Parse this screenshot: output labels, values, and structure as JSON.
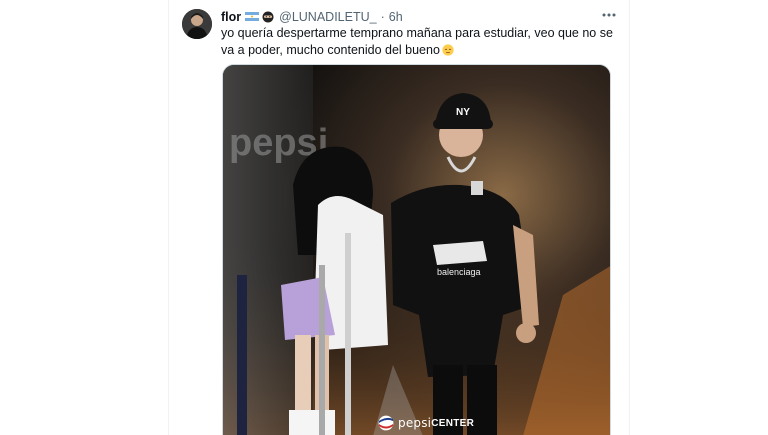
{
  "tweet": {
    "display_name": "flor",
    "handle": "@LUNADILETU_",
    "separator": "·",
    "time": "6h",
    "text": "yo quería despertarme temprano mañana para estudiar, veo que no se va a poder, mucho contenido del bueno",
    "emoji": "relieved-face"
  },
  "media": {
    "watermark_left": "pepsi",
    "watermark_right": "CENTER",
    "background_text": "pepsi"
  },
  "colors": {
    "text_primary": "#0f1419",
    "text_secondary": "#536471",
    "border": "#cfd9de"
  }
}
